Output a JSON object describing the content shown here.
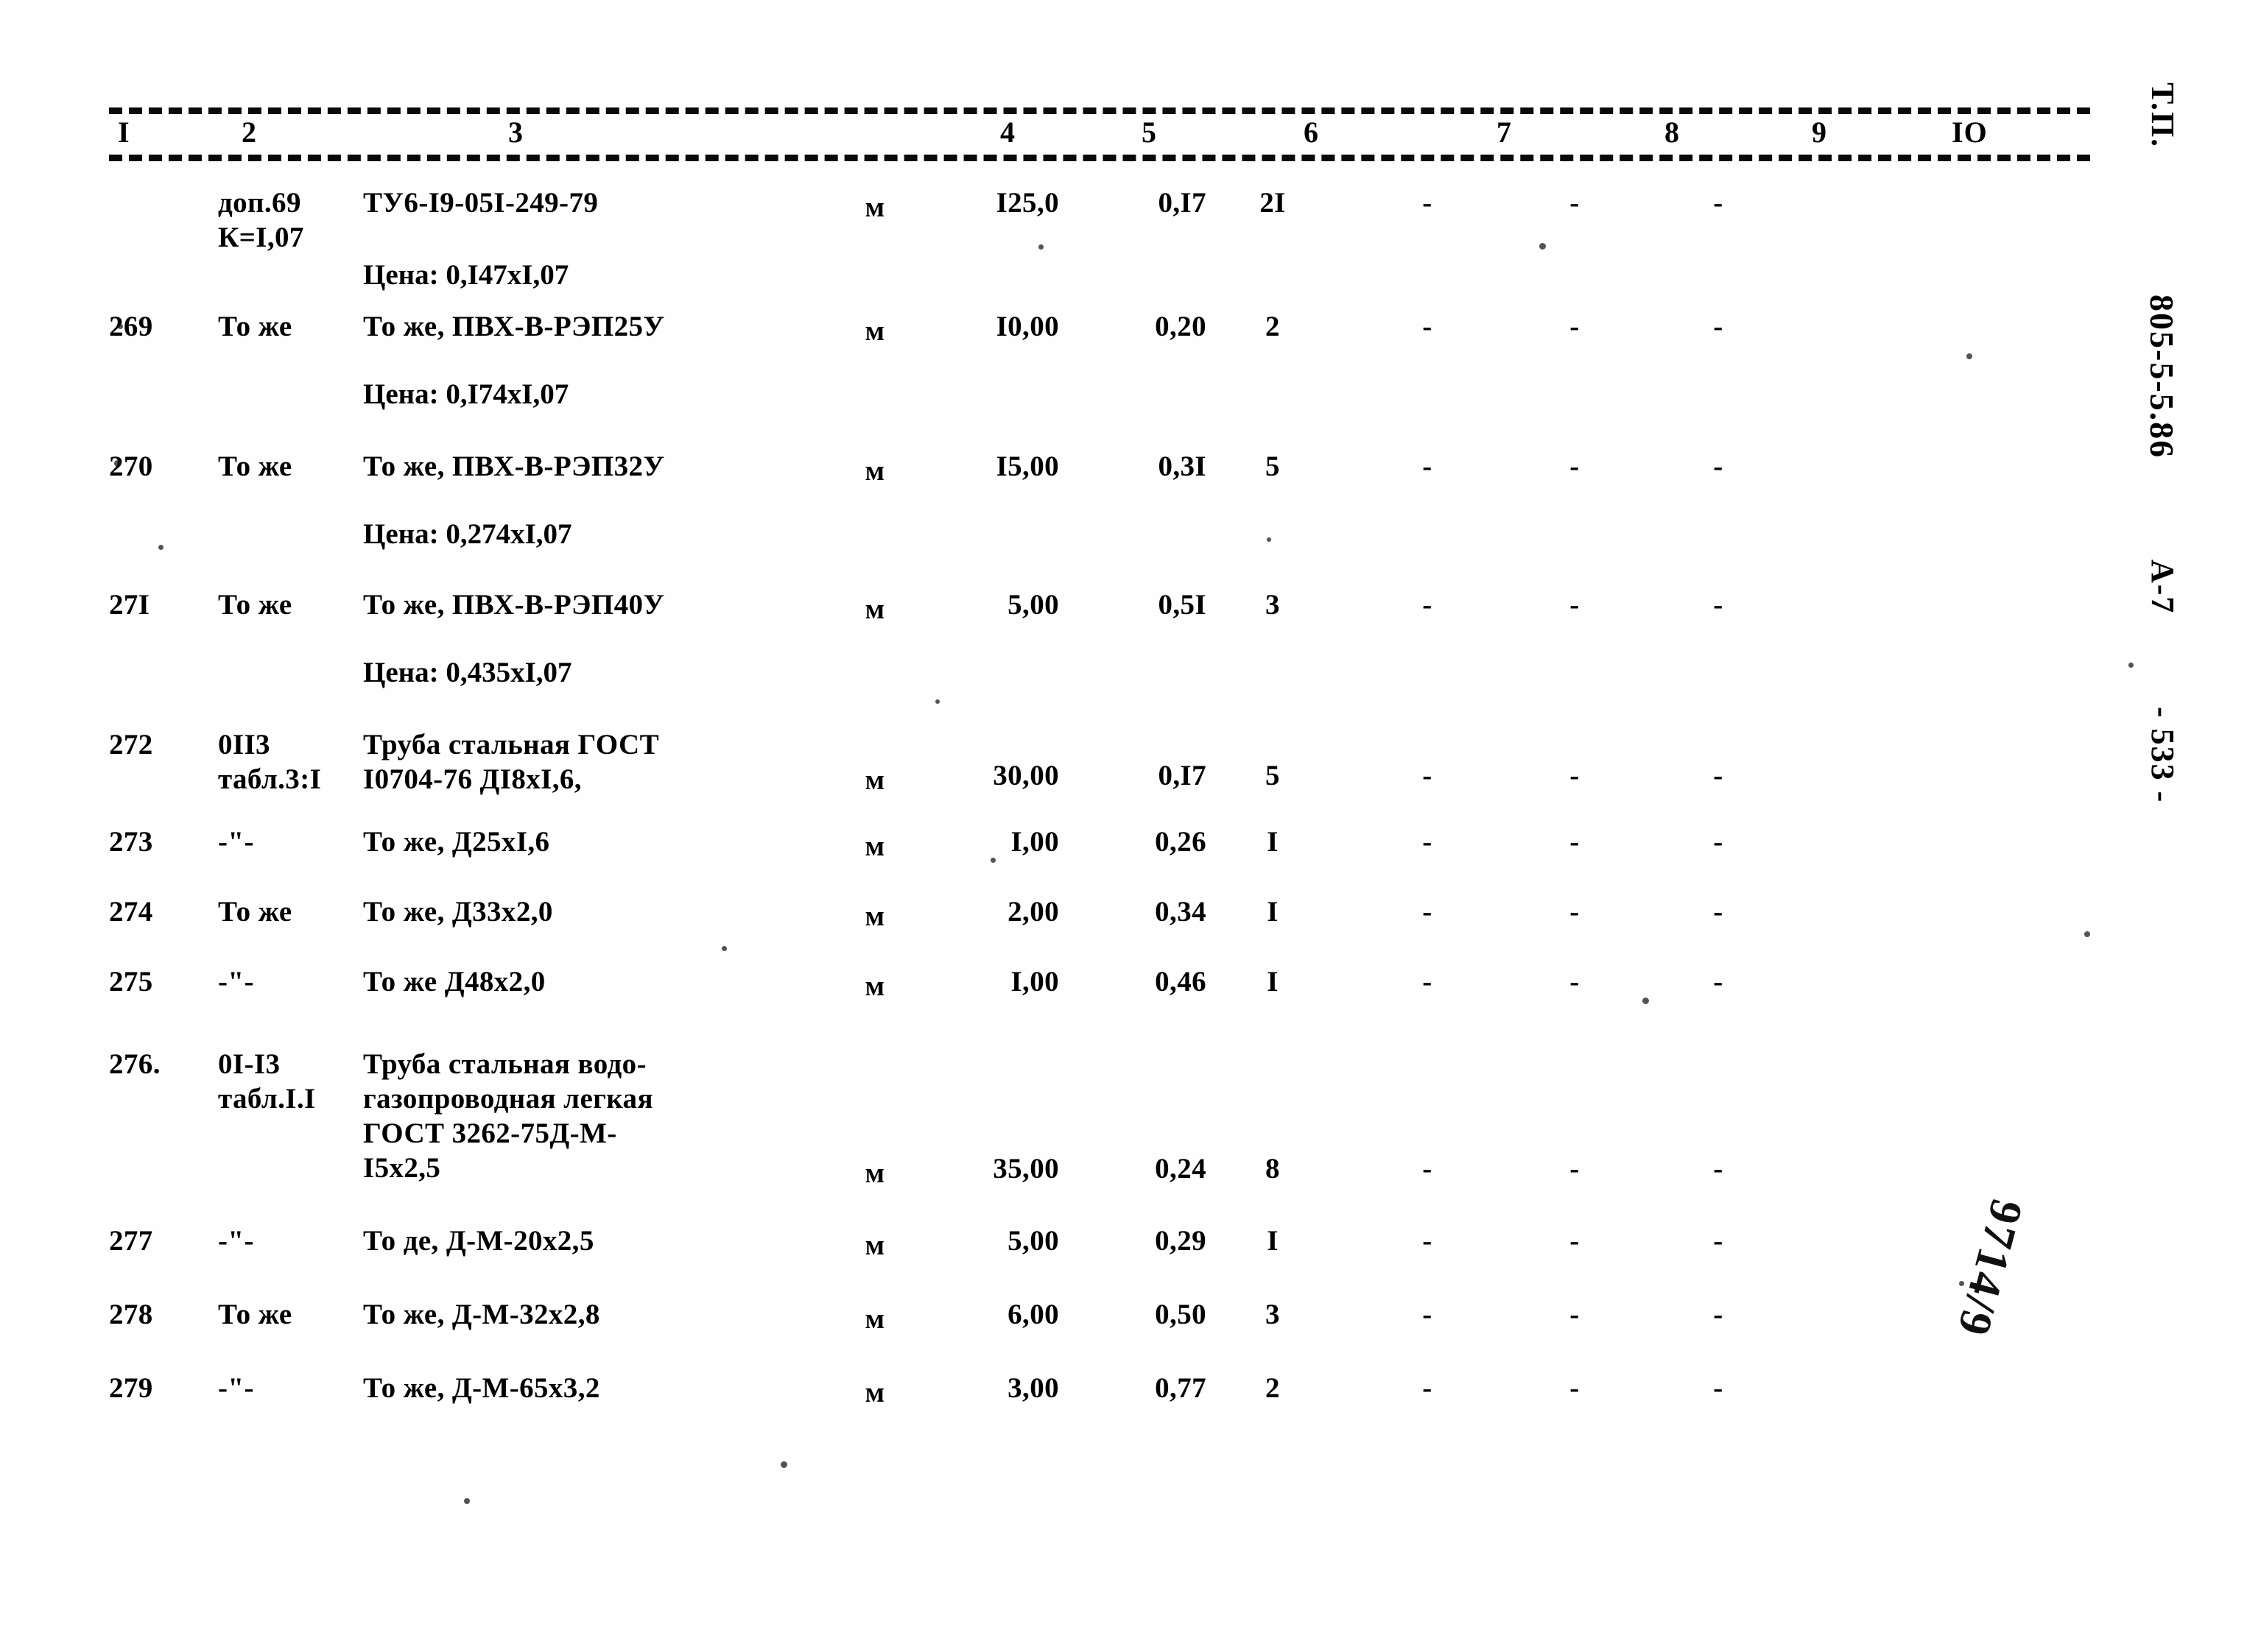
{
  "document": {
    "kind": "scanned-specification-table",
    "side_stamp": {
      "type_label": "Т.П.",
      "project_code": "805-5-5.86",
      "sheet": "А-7",
      "page": "- 533 -"
    },
    "handwritten_note": "9714/9"
  },
  "table": {
    "column_headers": [
      "I",
      "2",
      "3",
      "4",
      "5",
      "6",
      "7",
      "8",
      "9",
      "IO"
    ],
    "dash_symbol": "-",
    "rows": [
      {
        "c1": "",
        "c2": "доп.69\nК=I,07",
        "c3": "ТУ6-I9-05I-249-79",
        "price_note": "Цена: 0,I47хI,07",
        "c4": "м",
        "c5": "I25,0",
        "c6": "0,I7",
        "c7": "2I",
        "c8": "-",
        "c9": "-",
        "c10": "-"
      },
      {
        "c1": "269",
        "c2": "То же",
        "c3": "То же, ПВХ-В-РЭП25У",
        "price_note": "Цена: 0,I74хI,07",
        "c4": "м",
        "c5": "I0,00",
        "c6": "0,20",
        "c7": "2",
        "c8": "-",
        "c9": "-",
        "c10": "-"
      },
      {
        "c1": "270",
        "c2": "То же",
        "c3": "То же, ПВХ-В-РЭП32У",
        "price_note": "Цена: 0,274хI,07",
        "c4": "м",
        "c5": "I5,00",
        "c6": "0,3I",
        "c7": "5",
        "c8": "-",
        "c9": "-",
        "c10": "-"
      },
      {
        "c1": "27I",
        "c2": "То же",
        "c3": "То же, ПВХ-В-РЭП40У",
        "price_note": "Цена: 0,435хI,07",
        "c4": "м",
        "c5": "5,00",
        "c6": "0,5I",
        "c7": "3",
        "c8": "-",
        "c9": "-",
        "c10": "-"
      },
      {
        "c1": "272",
        "c2": "0II3\nтабл.3:I",
        "c3": "Труба стальная ГОСТ\nI0704-76 ДI8хI,6,",
        "price_note": "",
        "c4": "м",
        "c5": "30,00",
        "c6": "0,I7",
        "c7": "5",
        "c8": "-",
        "c9": "-",
        "c10": "-"
      },
      {
        "c1": "273",
        "c2": "-\"-",
        "c3": "То же, Д25хI,6",
        "price_note": "",
        "c4": "м",
        "c5": "I,00",
        "c6": "0,26",
        "c7": "I",
        "c8": "-",
        "c9": "-",
        "c10": "-"
      },
      {
        "c1": "274",
        "c2": "То же",
        "c3": "То же, Д33х2,0",
        "price_note": "",
        "c4": "м",
        "c5": "2,00",
        "c6": "0,34",
        "c7": "I",
        "c8": "-",
        "c9": "-",
        "c10": "-"
      },
      {
        "c1": "275",
        "c2": "-\"-",
        "c3": "То же Д48х2,0",
        "price_note": "",
        "c4": "м",
        "c5": "I,00",
        "c6": "0,46",
        "c7": "I",
        "c8": "-",
        "c9": "-",
        "c10": "-"
      },
      {
        "c1": "276.",
        "c2": "0I-I3\nтабл.I.I",
        "c3": "Труба стальная водо-\nгазопроводная легкая\nГОСТ 3262-75Д-М-\nI5х2,5",
        "price_note": "",
        "c4": "м",
        "c5": "35,00",
        "c6": "0,24",
        "c7": "8",
        "c8": "-",
        "c9": "-",
        "c10": "-"
      },
      {
        "c1": "277",
        "c2": "-\"-",
        "c3": "То де, Д-М-20х2,5",
        "price_note": "",
        "c4": "м",
        "c5": "5,00",
        "c6": "0,29",
        "c7": "I",
        "c8": "-",
        "c9": "-",
        "c10": "-"
      },
      {
        "c1": "278",
        "c2": "То же",
        "c3": "То же, Д-М-32х2,8",
        "price_note": "",
        "c4": "м",
        "c5": "6,00",
        "c6": "0,50",
        "c7": "3",
        "c8": "-",
        "c9": "-",
        "c10": "-"
      },
      {
        "c1": "279",
        "c2": "-\"-",
        "c3": "То же, Д-М-65х3,2",
        "price_note": "",
        "c4": "м",
        "c5": "3,00",
        "c6": "0,77",
        "c7": "2",
        "c8": "-",
        "c9": "-",
        "c10": "-"
      }
    ]
  }
}
